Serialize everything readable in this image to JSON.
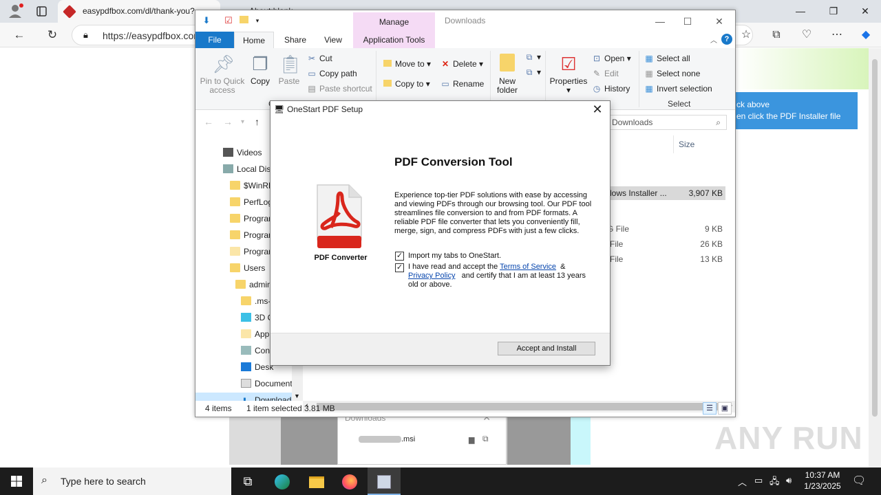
{
  "browser": {
    "tabs": [
      {
        "title": "easypdfbox.com/dl/thank-you?"
      },
      {
        "title": "About:blank"
      }
    ],
    "url": "https://easypdfbox.com"
  },
  "page": {
    "tooltip_line1": "ck above",
    "tooltip_line2": "en click the PDF Installer file"
  },
  "download_popup": {
    "title": "Downloads",
    "file_ext": ".msi"
  },
  "watermark": "ANY RUN",
  "explorer": {
    "manage_label": "Manage",
    "window_title": "Downloads",
    "tabs": [
      "File",
      "Home",
      "Share",
      "View",
      "Application Tools"
    ],
    "ribbon": {
      "pin_line1": "Pin to Quick",
      "pin_line2": "access",
      "copy": "Copy",
      "paste": "Paste",
      "cut": "Cut",
      "copy_path": "Copy path",
      "paste_shortcut": "Paste shortcut",
      "move_to": "Move to",
      "copy_to": "Copy to",
      "delete": "Delete",
      "rename": "Rename",
      "new_folder_line1": "New",
      "new_folder_line2": "folder",
      "properties": "Properties",
      "open": "Open",
      "edit": "Edit",
      "history": "History",
      "select_all": "Select all",
      "select_none": "Select none",
      "invert_selection": "Invert selection",
      "select_group": "Select",
      "clipboard_group_initial": "C"
    },
    "search_placeholder": "ch Downloads",
    "tree": [
      {
        "label": "Videos"
      },
      {
        "label": "Local Dis"
      },
      {
        "label": "$WinRE"
      },
      {
        "label": "PerfLog"
      },
      {
        "label": "Progran"
      },
      {
        "label": "Progran"
      },
      {
        "label": "Progran"
      },
      {
        "label": "Users"
      },
      {
        "label": "admin"
      },
      {
        "label": ".ms-"
      },
      {
        "label": "3D O"
      },
      {
        "label": "Appl"
      },
      {
        "label": "Cont"
      },
      {
        "label": "Desk"
      },
      {
        "label": "Document"
      },
      {
        "label": "Download"
      }
    ],
    "columns": {
      "name": "e",
      "size": "Size"
    },
    "files": [
      {
        "type": "dows Installer ...",
        "size": "3,907 KB"
      },
      {
        "type": "G File",
        "size": "9 KB"
      },
      {
        "type": "File",
        "size": "26 KB"
      },
      {
        "type": "File",
        "size": "13 KB"
      }
    ],
    "status": {
      "items": "4 items",
      "selected": "1 item selected",
      "size": "3.81 MB"
    }
  },
  "dialog": {
    "title": "OneStart PDF Setup",
    "heading": "PDF Conversion Tool",
    "description": "Experience top-tier PDF solutions with ease by accessing and viewing PDFs through our browsing tool. Our PDF tool streamlines file conversion to and from PDF formats. A reliable PDF file converter that lets you conveniently fill, merge, sign, and compress PDFs with just a few clicks.",
    "icon_label": "PDF Converter",
    "import_tabs": "Import my tabs to OneStart.",
    "accept_prefix": "I have read and accept the",
    "terms_link": "Terms of Service",
    "amp": "&",
    "privacy_link": "Privacy Policy",
    "accept_suffix": "and certify that I am at least 13 years old or above.",
    "button": "Accept and Install"
  },
  "taskbar": {
    "search_placeholder": "Type here to search",
    "time": "10:37 AM",
    "date": "1/23/2025"
  },
  "colors": {
    "accent": "#1979ca",
    "manage_tab": "#f5dbf5",
    "tooltip": "#3b95de",
    "pdf_red": "#d9261c"
  }
}
